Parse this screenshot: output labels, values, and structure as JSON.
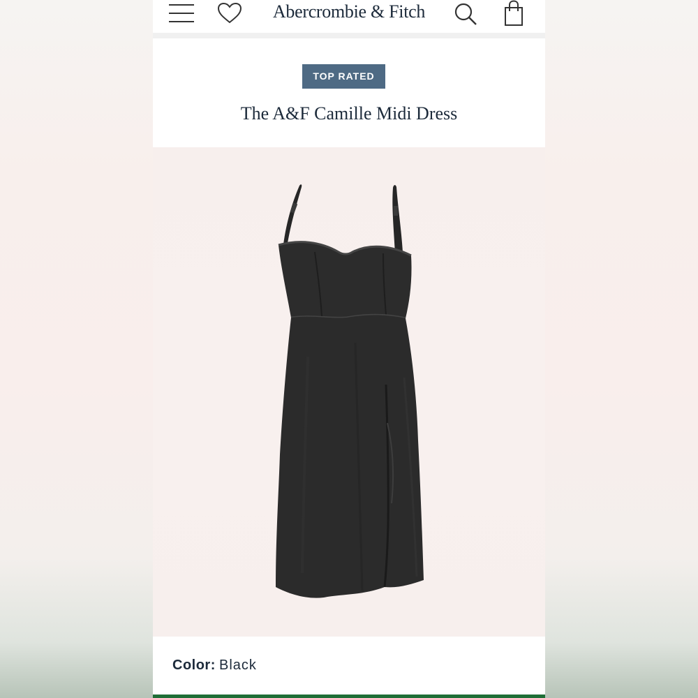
{
  "header": {
    "brand": "Abercrombie & Fitch",
    "icons": [
      "menu-icon",
      "heart-icon",
      "search-icon",
      "bag-icon"
    ]
  },
  "product": {
    "badge": "TOP RATED",
    "title": "The A&F Camille Midi Dress",
    "color_label": "Color:",
    "color_value": "Black"
  },
  "colors": {
    "badge_bg": "#4e6a84",
    "text": "#1c2a3a",
    "bottom_bar": "#1f6e36",
    "dress": "#2b2b2b"
  }
}
